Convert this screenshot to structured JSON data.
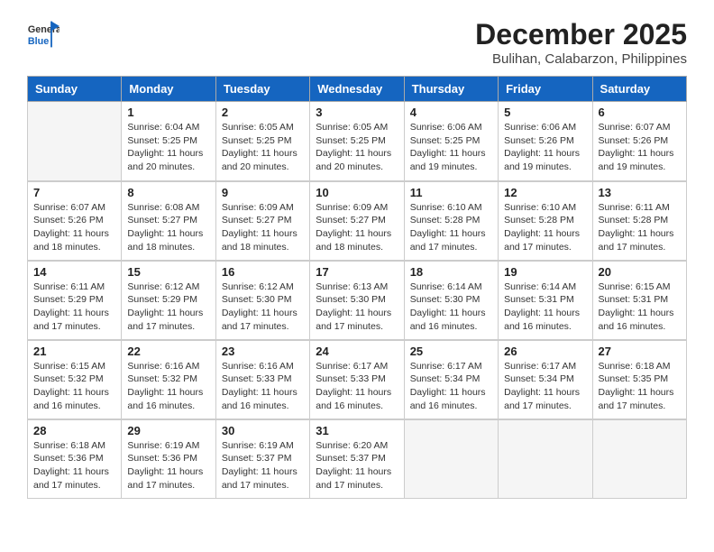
{
  "header": {
    "logo_general": "General",
    "logo_blue": "Blue",
    "month_title": "December 2025",
    "location": "Bulihan, Calabarzon, Philippines"
  },
  "days_of_week": [
    "Sunday",
    "Monday",
    "Tuesday",
    "Wednesday",
    "Thursday",
    "Friday",
    "Saturday"
  ],
  "weeks": [
    [
      {
        "day": "",
        "info": ""
      },
      {
        "day": "1",
        "info": "Sunrise: 6:04 AM\nSunset: 5:25 PM\nDaylight: 11 hours\nand 20 minutes."
      },
      {
        "day": "2",
        "info": "Sunrise: 6:05 AM\nSunset: 5:25 PM\nDaylight: 11 hours\nand 20 minutes."
      },
      {
        "day": "3",
        "info": "Sunrise: 6:05 AM\nSunset: 5:25 PM\nDaylight: 11 hours\nand 20 minutes."
      },
      {
        "day": "4",
        "info": "Sunrise: 6:06 AM\nSunset: 5:25 PM\nDaylight: 11 hours\nand 19 minutes."
      },
      {
        "day": "5",
        "info": "Sunrise: 6:06 AM\nSunset: 5:26 PM\nDaylight: 11 hours\nand 19 minutes."
      },
      {
        "day": "6",
        "info": "Sunrise: 6:07 AM\nSunset: 5:26 PM\nDaylight: 11 hours\nand 19 minutes."
      }
    ],
    [
      {
        "day": "7",
        "info": "Sunrise: 6:07 AM\nSunset: 5:26 PM\nDaylight: 11 hours\nand 18 minutes."
      },
      {
        "day": "8",
        "info": "Sunrise: 6:08 AM\nSunset: 5:27 PM\nDaylight: 11 hours\nand 18 minutes."
      },
      {
        "day": "9",
        "info": "Sunrise: 6:09 AM\nSunset: 5:27 PM\nDaylight: 11 hours\nand 18 minutes."
      },
      {
        "day": "10",
        "info": "Sunrise: 6:09 AM\nSunset: 5:27 PM\nDaylight: 11 hours\nand 18 minutes."
      },
      {
        "day": "11",
        "info": "Sunrise: 6:10 AM\nSunset: 5:28 PM\nDaylight: 11 hours\nand 17 minutes."
      },
      {
        "day": "12",
        "info": "Sunrise: 6:10 AM\nSunset: 5:28 PM\nDaylight: 11 hours\nand 17 minutes."
      },
      {
        "day": "13",
        "info": "Sunrise: 6:11 AM\nSunset: 5:28 PM\nDaylight: 11 hours\nand 17 minutes."
      }
    ],
    [
      {
        "day": "14",
        "info": "Sunrise: 6:11 AM\nSunset: 5:29 PM\nDaylight: 11 hours\nand 17 minutes."
      },
      {
        "day": "15",
        "info": "Sunrise: 6:12 AM\nSunset: 5:29 PM\nDaylight: 11 hours\nand 17 minutes."
      },
      {
        "day": "16",
        "info": "Sunrise: 6:12 AM\nSunset: 5:30 PM\nDaylight: 11 hours\nand 17 minutes."
      },
      {
        "day": "17",
        "info": "Sunrise: 6:13 AM\nSunset: 5:30 PM\nDaylight: 11 hours\nand 17 minutes."
      },
      {
        "day": "18",
        "info": "Sunrise: 6:14 AM\nSunset: 5:30 PM\nDaylight: 11 hours\nand 16 minutes."
      },
      {
        "day": "19",
        "info": "Sunrise: 6:14 AM\nSunset: 5:31 PM\nDaylight: 11 hours\nand 16 minutes."
      },
      {
        "day": "20",
        "info": "Sunrise: 6:15 AM\nSunset: 5:31 PM\nDaylight: 11 hours\nand 16 minutes."
      }
    ],
    [
      {
        "day": "21",
        "info": "Sunrise: 6:15 AM\nSunset: 5:32 PM\nDaylight: 11 hours\nand 16 minutes."
      },
      {
        "day": "22",
        "info": "Sunrise: 6:16 AM\nSunset: 5:32 PM\nDaylight: 11 hours\nand 16 minutes."
      },
      {
        "day": "23",
        "info": "Sunrise: 6:16 AM\nSunset: 5:33 PM\nDaylight: 11 hours\nand 16 minutes."
      },
      {
        "day": "24",
        "info": "Sunrise: 6:17 AM\nSunset: 5:33 PM\nDaylight: 11 hours\nand 16 minutes."
      },
      {
        "day": "25",
        "info": "Sunrise: 6:17 AM\nSunset: 5:34 PM\nDaylight: 11 hours\nand 16 minutes."
      },
      {
        "day": "26",
        "info": "Sunrise: 6:17 AM\nSunset: 5:34 PM\nDaylight: 11 hours\nand 17 minutes."
      },
      {
        "day": "27",
        "info": "Sunrise: 6:18 AM\nSunset: 5:35 PM\nDaylight: 11 hours\nand 17 minutes."
      }
    ],
    [
      {
        "day": "28",
        "info": "Sunrise: 6:18 AM\nSunset: 5:36 PM\nDaylight: 11 hours\nand 17 minutes."
      },
      {
        "day": "29",
        "info": "Sunrise: 6:19 AM\nSunset: 5:36 PM\nDaylight: 11 hours\nand 17 minutes."
      },
      {
        "day": "30",
        "info": "Sunrise: 6:19 AM\nSunset: 5:37 PM\nDaylight: 11 hours\nand 17 minutes."
      },
      {
        "day": "31",
        "info": "Sunrise: 6:20 AM\nSunset: 5:37 PM\nDaylight: 11 hours\nand 17 minutes."
      },
      {
        "day": "",
        "info": ""
      },
      {
        "day": "",
        "info": ""
      },
      {
        "day": "",
        "info": ""
      }
    ]
  ]
}
